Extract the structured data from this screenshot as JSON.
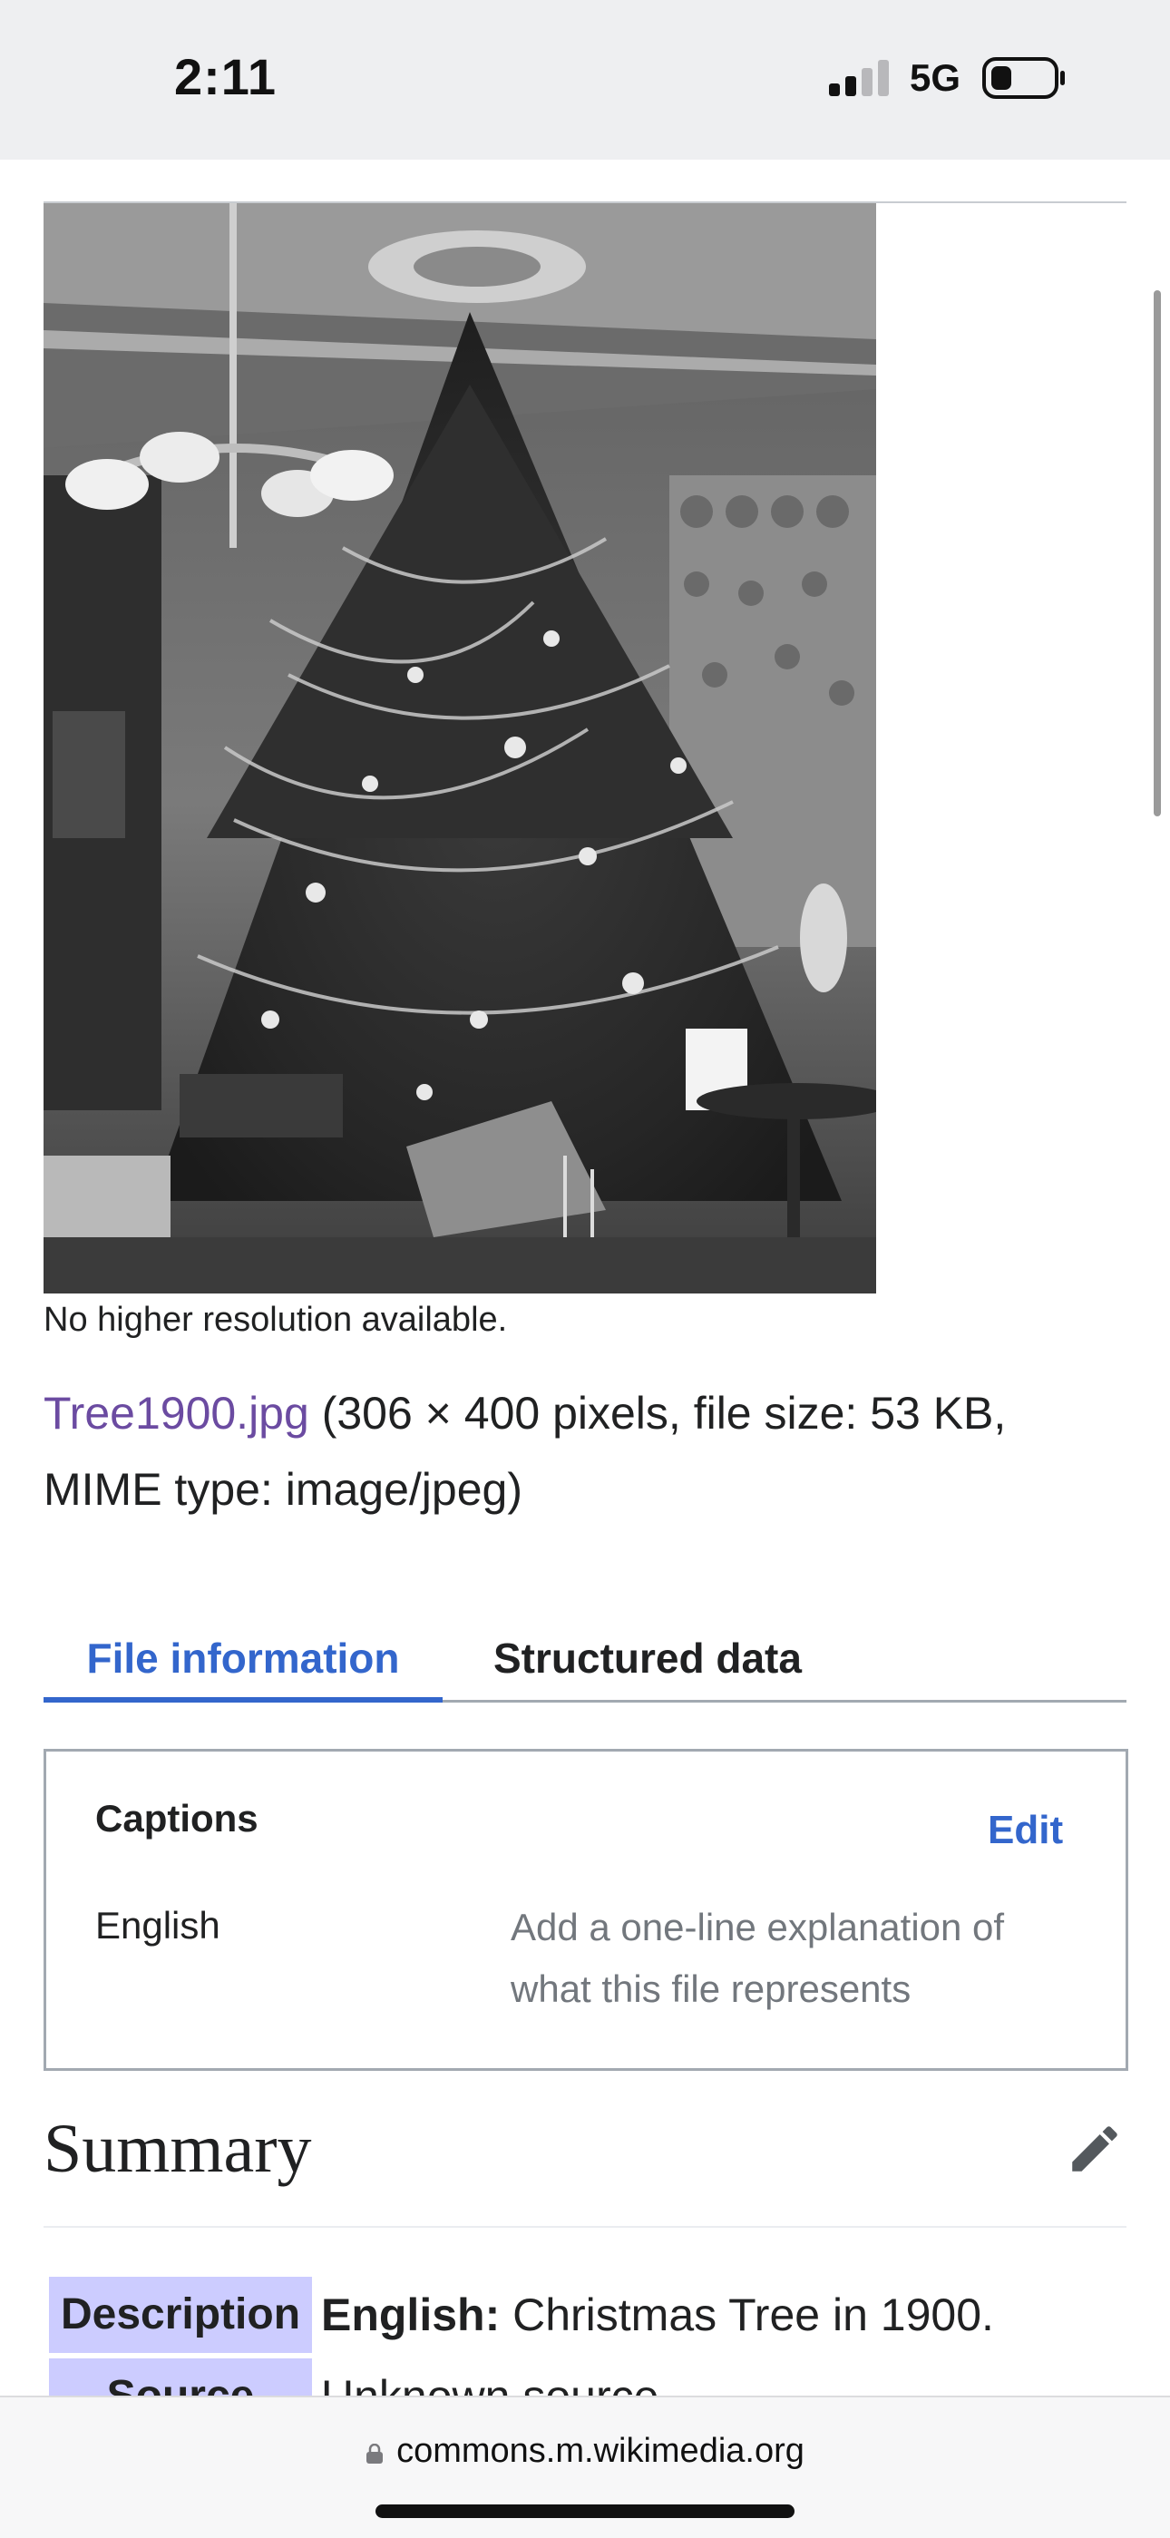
{
  "status_bar": {
    "time": "2:11",
    "network": "5G",
    "signal_bars": 2,
    "battery_level": 0.2
  },
  "image": {
    "alt": "Christmas tree photograph",
    "note": "No higher resolution available."
  },
  "file_info": {
    "file_name": "Tree1900.jpg",
    "details": " (306 × 400 pixels, file size: 53 KB, MIME type: image/jpeg)"
  },
  "tabs": [
    {
      "label": "File information",
      "active": true
    },
    {
      "label": "Structured data",
      "active": false
    }
  ],
  "captions": {
    "title": "Captions",
    "edit_label": "Edit",
    "language": "English",
    "placeholder": "Add a one-line explanation of what this file represents"
  },
  "summary": {
    "heading": "Summary",
    "description_label": "Description",
    "description_lang": "English:",
    "description_text": " Christmas Tree in 1900.",
    "source_label": "Source",
    "source_text": "Unknown source"
  },
  "browser": {
    "url": "commons.m.wikimedia.org"
  },
  "colors": {
    "link": "#3366cc",
    "visited_link": "#6b4ba1",
    "label_bg": "#ccccff"
  }
}
